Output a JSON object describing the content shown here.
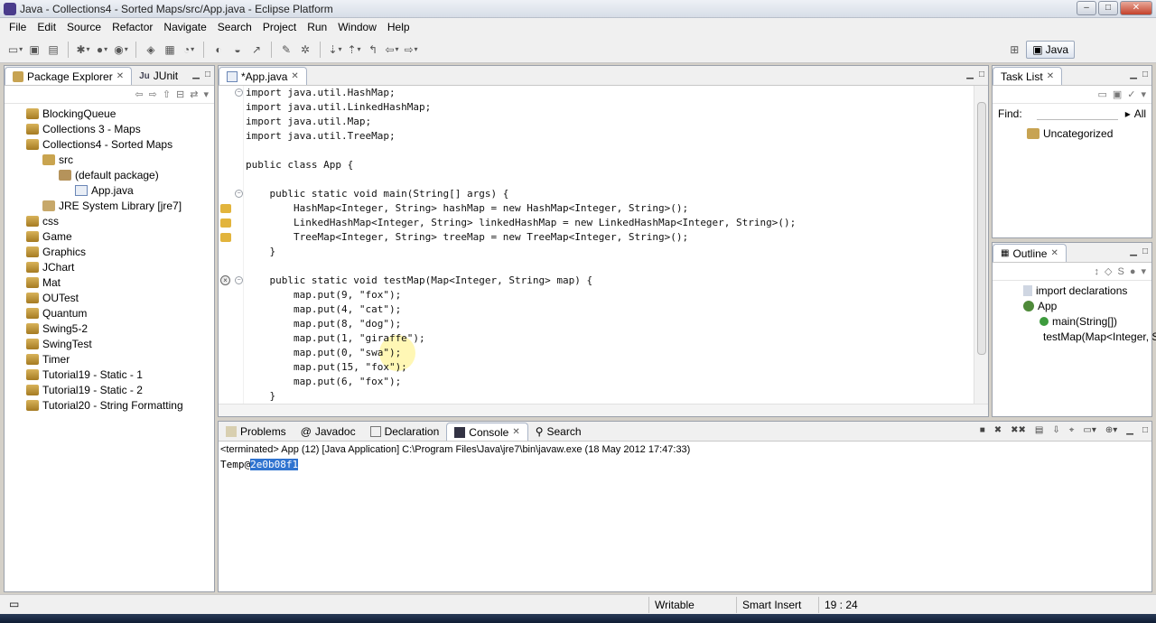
{
  "window": {
    "title": "Java - Collections4 - Sorted Maps/src/App.java - Eclipse Platform"
  },
  "menu": [
    "File",
    "Edit",
    "Source",
    "Refactor",
    "Navigate",
    "Search",
    "Project",
    "Run",
    "Window",
    "Help"
  ],
  "perspective": {
    "label": "Java"
  },
  "package_explorer": {
    "tabs": [
      {
        "label": "Package Explorer"
      },
      {
        "label": "JUnit"
      }
    ],
    "items": [
      {
        "label": "BlockingQueue",
        "depth": 1,
        "kind": "project"
      },
      {
        "label": "Collections 3 - Maps",
        "depth": 1,
        "kind": "project"
      },
      {
        "label": "Collections4 - Sorted Maps",
        "depth": 1,
        "kind": "project"
      },
      {
        "label": "src",
        "depth": 2,
        "kind": "src"
      },
      {
        "label": "(default package)",
        "depth": 3,
        "kind": "package"
      },
      {
        "label": "App.java",
        "depth": 4,
        "kind": "file"
      },
      {
        "label": "JRE System Library [jre7]",
        "depth": 2,
        "kind": "lib"
      },
      {
        "label": "css",
        "depth": 1,
        "kind": "project"
      },
      {
        "label": "Game",
        "depth": 1,
        "kind": "project"
      },
      {
        "label": "Graphics",
        "depth": 1,
        "kind": "project"
      },
      {
        "label": "JChart",
        "depth": 1,
        "kind": "project"
      },
      {
        "label": "Mat",
        "depth": 1,
        "kind": "project"
      },
      {
        "label": "OUTest",
        "depth": 1,
        "kind": "project"
      },
      {
        "label": "Quantum",
        "depth": 1,
        "kind": "project"
      },
      {
        "label": "Swing5-2",
        "depth": 1,
        "kind": "project"
      },
      {
        "label": "SwingTest",
        "depth": 1,
        "kind": "project"
      },
      {
        "label": "Timer",
        "depth": 1,
        "kind": "project"
      },
      {
        "label": "Tutorial19 - Static - 1",
        "depth": 1,
        "kind": "project"
      },
      {
        "label": "Tutorial19 - Static - 2",
        "depth": 1,
        "kind": "project"
      },
      {
        "label": "Tutorial20 - String Formatting",
        "depth": 1,
        "kind": "project"
      }
    ]
  },
  "editor": {
    "tab_label": "*App.java",
    "lines": [
      "import java.util.HashMap;",
      "import java.util.LinkedHashMap;",
      "import java.util.Map;",
      "import java.util.TreeMap;",
      "",
      "public class App {",
      "",
      "    public static void main(String[] args) {",
      "        HashMap<Integer, String> hashMap = new HashMap<Integer, String>();",
      "        LinkedHashMap<Integer, String> linkedHashMap = new LinkedHashMap<Integer, String>();",
      "        TreeMap<Integer, String> treeMap = new TreeMap<Integer, String>();",
      "    }",
      "",
      "    public static void testMap(Map<Integer, String> map) {",
      "        map.put(9, \"fox\");",
      "        map.put(4, \"cat\");",
      "        map.put(8, \"dog\");",
      "        map.put(1, \"giraffe\");",
      "        map.put(0, \"swa\");",
      "        map.put(15, \"fox\");",
      "        map.put(6, \"fox\");",
      "    }"
    ]
  },
  "task_list": {
    "tab_label": "Task List",
    "find_label": "Find:",
    "all_label": "All",
    "category": "Uncategorized"
  },
  "outline": {
    "tab_label": "Outline",
    "items": [
      {
        "label": "import declarations"
      },
      {
        "label": "App"
      },
      {
        "label": "main(String[])"
      },
      {
        "label": "testMap(Map<Integer, String>)"
      }
    ]
  },
  "console": {
    "tabs": [
      {
        "label": "Problems"
      },
      {
        "label": "Javadoc"
      },
      {
        "label": "Declaration"
      },
      {
        "label": "Console"
      },
      {
        "label": "Search"
      }
    ],
    "status": "<terminated> App (12) [Java Application] C:\\Program Files\\Java\\jre7\\bin\\javaw.exe (18 May 2012 17:47:33)",
    "output_prefix": "Temp@",
    "output_selected": "2e0b08f1"
  },
  "statusbar": {
    "mode": "Writable",
    "insert": "Smart Insert",
    "position": "19 : 24"
  }
}
